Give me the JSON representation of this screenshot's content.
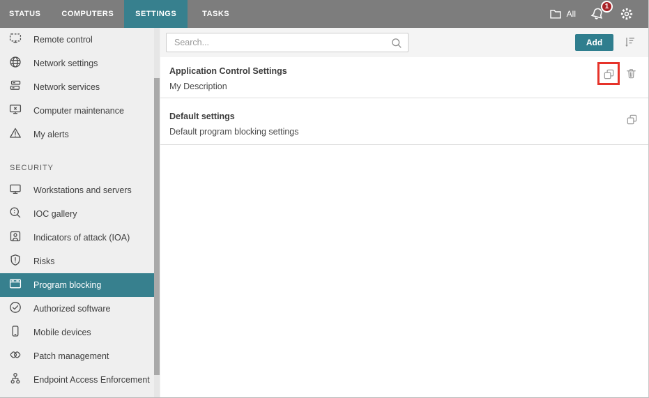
{
  "nav": {
    "tabs": [
      {
        "label": "STATUS",
        "active": false
      },
      {
        "label": "COMPUTERS",
        "active": false
      },
      {
        "label": "SETTINGS",
        "active": true
      },
      {
        "label": "TASKS",
        "active": false
      }
    ],
    "folder_label": "All",
    "notification_count": "1"
  },
  "sidebar": {
    "items_general": [
      "Remote control",
      "Network settings",
      "Network services",
      "Computer maintenance",
      "My alerts"
    ],
    "section_header": "SECURITY",
    "items_security": [
      "Workstations and servers",
      "IOC gallery",
      "Indicators of attack (IOA)",
      "Risks",
      "Program blocking",
      "Authorized software",
      "Mobile devices",
      "Patch management",
      "Endpoint Access Enforcement"
    ],
    "active_item": "Program blocking"
  },
  "toolbar": {
    "search_placeholder": "Search...",
    "search_value": "",
    "add_label": "Add"
  },
  "list": {
    "rows": [
      {
        "title": "Application Control Settings",
        "description": "My Description"
      },
      {
        "title": "Default settings",
        "description": "Default program blocking settings"
      }
    ]
  },
  "colors": {
    "accent_teal": "#37808e",
    "nav_gray": "#7d7d7d",
    "badge_red": "#a82227",
    "annotation_red": "#e6332a"
  }
}
